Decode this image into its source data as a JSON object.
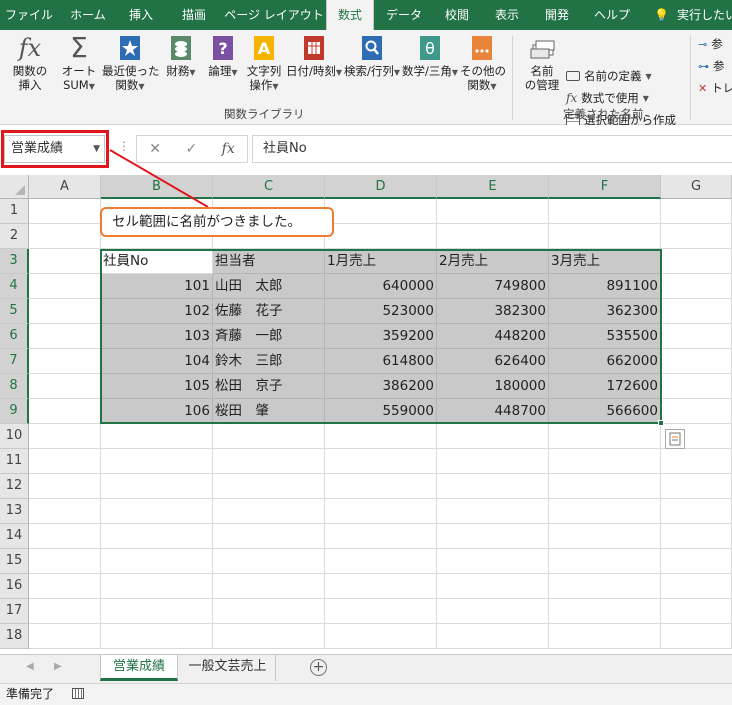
{
  "tabs": [
    {
      "label": "ファイル"
    },
    {
      "label": "ホーム"
    },
    {
      "label": "挿入"
    },
    {
      "label": "描画"
    },
    {
      "label": "ページ レイアウト"
    },
    {
      "label": "数式"
    },
    {
      "label": "データ"
    },
    {
      "label": "校閲"
    },
    {
      "label": "表示"
    },
    {
      "label": "開発"
    },
    {
      "label": "ヘルプ"
    },
    {
      "label": "実行したい"
    }
  ],
  "ribbon": {
    "insert_function": [
      "関数の",
      "挿入"
    ],
    "autosum": [
      "オート",
      "SUM"
    ],
    "recent": [
      "最近使った",
      "関数"
    ],
    "financial": "財務",
    "logical": "論理",
    "text": [
      "文字列",
      "操作"
    ],
    "datetime": "日付/時刻",
    "lookup": "検索/行列",
    "math": "数学/三角",
    "more": [
      "その他の",
      "関数"
    ],
    "library_label": "関数ライブラリ",
    "name_manager": [
      "名前",
      "の管理"
    ],
    "define_name": "名前の定義",
    "use_in_formula": "数式で使用",
    "create_from_selection": "選択範囲から作成",
    "defined_names_label": "定義された名前",
    "trace_precedents": "参",
    "trace_dependents": "参",
    "remove_arrows": "トレ"
  },
  "formula_bar": {
    "name_box": "営業成績",
    "formula": "社員No"
  },
  "columns": [
    "A",
    "B",
    "C",
    "D",
    "E",
    "F",
    "G"
  ],
  "rows": [
    "1",
    "2",
    "3",
    "4",
    "5",
    "6",
    "7",
    "8",
    "9",
    "10",
    "11",
    "12",
    "13",
    "14",
    "15",
    "16",
    "17",
    "18"
  ],
  "callout": "セル範囲に名前がつきました。",
  "table": {
    "headers": [
      "社員No",
      "担当者",
      "1月売上",
      "2月売上",
      "3月売上"
    ],
    "rows": [
      [
        "101",
        "山田　太郎",
        "640000",
        "749800",
        "891100"
      ],
      [
        "102",
        "佐藤　花子",
        "523000",
        "382300",
        "362300"
      ],
      [
        "103",
        "斉藤　一郎",
        "359200",
        "448200",
        "535500"
      ],
      [
        "104",
        "鈴木　三郎",
        "614800",
        "626400",
        "662000"
      ],
      [
        "105",
        "松田　京子",
        "386200",
        "180000",
        "172600"
      ],
      [
        "106",
        "桜田　肇",
        "559000",
        "448700",
        "566600"
      ]
    ]
  },
  "sheets": [
    {
      "label": "営業成績"
    },
    {
      "label": "一般文芸売上"
    }
  ],
  "status": "準備完了",
  "colors": {
    "accent": "#217346",
    "highlight": "#e0161c",
    "callout_border": "#ed7d31",
    "selection_fill": "#c9c9c9"
  }
}
